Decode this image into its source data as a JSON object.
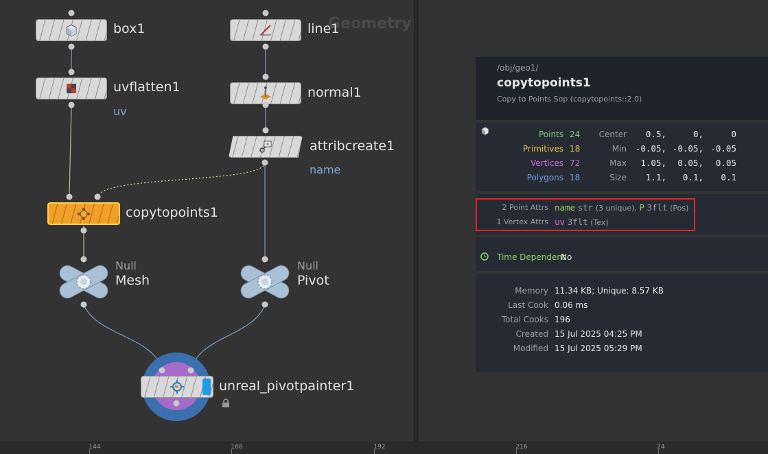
{
  "network": {
    "watermark": "Geometry",
    "nodes": {
      "box": {
        "label": "box1"
      },
      "line": {
        "label": "line1"
      },
      "uvflatten": {
        "label": "uvflatten1",
        "flag": "uv"
      },
      "normal": {
        "label": "normal1"
      },
      "attribcreate": {
        "label": "attribcreate1",
        "flag": "name"
      },
      "copytopoints": {
        "label": "copytopoints1"
      },
      "null_mesh": {
        "type": "Null",
        "label": "Mesh"
      },
      "null_pivot": {
        "type": "Null",
        "label": "Pivot"
      },
      "pivotpainter": {
        "label": "unreal_pivotpainter1"
      }
    }
  },
  "ruler": {
    "ticks": [
      "144",
      "168",
      "192",
      "216",
      "24"
    ]
  },
  "info": {
    "path": "/obj/geo1/",
    "node_name": "copytopoints1",
    "node_type": "Copy to Points Sop (copytopoints::2.0)",
    "counts": [
      {
        "label": "Points",
        "value": "24",
        "color": "#7fc97f"
      },
      {
        "label": "Primitives",
        "value": "18",
        "color": "#e2c24a"
      },
      {
        "label": "Vertices",
        "value": "72",
        "color": "#d36ad6"
      },
      {
        "label": "Polygons",
        "value": "18",
        "color": "#6f9be0"
      }
    ],
    "bounds": [
      {
        "label": "Center",
        "v1": "0.5,",
        "v2": "0,",
        "v3": "0"
      },
      {
        "label": "Min",
        "v1": "-0.05,",
        "v2": "-0.05,",
        "v3": "-0.05"
      },
      {
        "label": "Max",
        "v1": "1.05,",
        "v2": "0.05,",
        "v3": "0.05"
      },
      {
        "label": "Size",
        "v1": "1.1,",
        "v2": "0.1,",
        "v3": "0.1"
      }
    ],
    "point_attrs_label": "2 Point Attrs",
    "point_attr1_name": "name",
    "point_attr1_type": "str",
    "point_attr1_info": "(3 unique)",
    "point_attr2_name": "P",
    "point_attr2_type": "3flt",
    "point_attr2_info": "(Pos)",
    "vertex_attrs_label": "1 Vertex Attrs",
    "vertex_attr1_name": "uv",
    "vertex_attr1_type": "3flt",
    "vertex_attr1_info": "(Tex)",
    "time_dep_label": "Time Dependent",
    "time_dep_value": "No",
    "stats": [
      {
        "label": "Memory",
        "value": "11.34 KB; Unique: 8.57 KB"
      },
      {
        "label": "Last Cook",
        "value": "0.06 ms"
      },
      {
        "label": "Total Cooks",
        "value": "196"
      },
      {
        "label": "Created",
        "value": "15 Jul 2025 04:25 PM"
      },
      {
        "label": "Modified",
        "value": "15 Jul 2025 05:29 PM"
      }
    ],
    "colors": {
      "name_attr": "#8fd16a",
      "p_attr": "#8fd16a",
      "uv_attr": "#d36ad6",
      "highlight": "#e0242a"
    }
  }
}
